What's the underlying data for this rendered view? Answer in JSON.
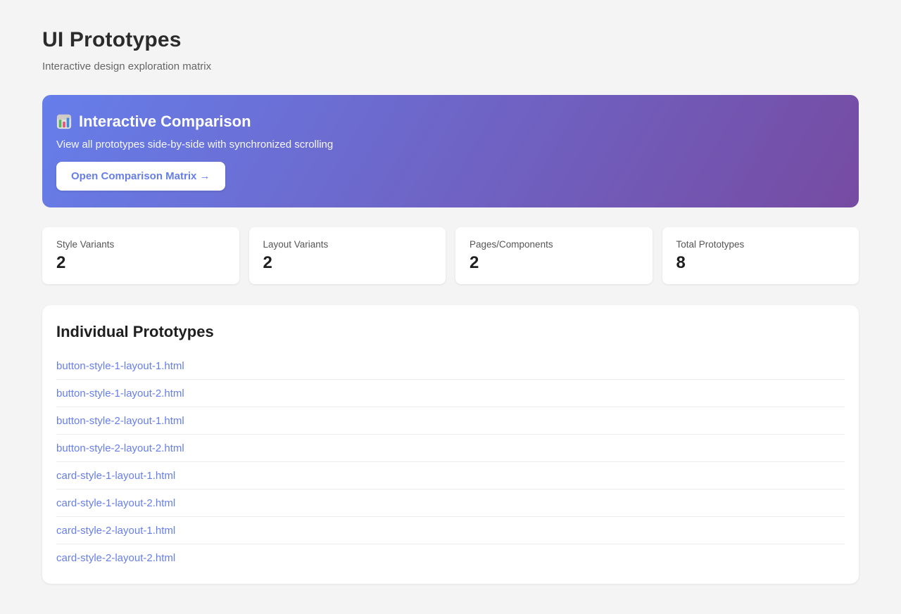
{
  "page": {
    "title": "UI Prototypes",
    "subtitle": "Interactive design exploration matrix"
  },
  "banner": {
    "icon": "bar-chart-emoji",
    "title": "Interactive Comparison",
    "description": "View all prototypes side-by-side with synchronized scrolling",
    "button_label": "Open Comparison Matrix →",
    "gradient_start": "#667eea",
    "gradient_end": "#764ba2"
  },
  "stats": [
    {
      "label": "Style Variants",
      "value": "2"
    },
    {
      "label": "Layout Variants",
      "value": "2"
    },
    {
      "label": "Pages/Components",
      "value": "2"
    },
    {
      "label": "Total Prototypes",
      "value": "8"
    }
  ],
  "prototypes": {
    "heading": "Individual Prototypes",
    "links": [
      "button-style-1-layout-1.html",
      "button-style-1-layout-2.html",
      "button-style-2-layout-1.html",
      "button-style-2-layout-2.html",
      "card-style-1-layout-1.html",
      "card-style-1-layout-2.html",
      "card-style-2-layout-1.html",
      "card-style-2-layout-2.html"
    ]
  },
  "colors": {
    "accent": "#667eea",
    "background": "#f4f4f4",
    "link": "#667eea"
  }
}
